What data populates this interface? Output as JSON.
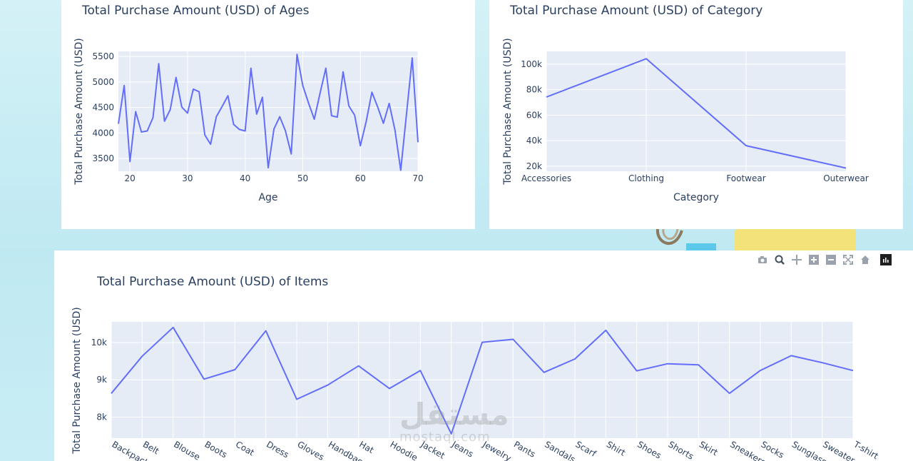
{
  "watermark": {
    "arabic": "مستقل",
    "latin": "mostaql.com"
  },
  "modebar": {
    "icons": [
      "camera-icon",
      "zoom-icon",
      "pan-icon",
      "zoom-in-icon",
      "zoom-out-icon",
      "autoscale-icon",
      "reset-axes-icon",
      "plotly-logo-icon"
    ]
  },
  "chart_data": [
    {
      "type": "line",
      "title": "Total Purchase Amount (USD) of Ages",
      "xlabel": "Age",
      "ylabel": "Total Purchase Amount (USD)",
      "x": [
        18,
        19,
        20,
        21,
        22,
        23,
        24,
        25,
        26,
        27,
        28,
        29,
        30,
        31,
        32,
        33,
        34,
        35,
        36,
        37,
        38,
        39,
        40,
        41,
        42,
        43,
        44,
        45,
        46,
        47,
        48,
        49,
        50,
        51,
        52,
        53,
        54,
        55,
        56,
        57,
        58,
        59,
        60,
        61,
        62,
        63,
        64,
        65,
        66,
        67,
        68,
        69,
        70
      ],
      "values": [
        4180,
        4930,
        3440,
        4420,
        4020,
        4040,
        4300,
        5360,
        4230,
        4460,
        5090,
        4510,
        4390,
        4860,
        4810,
        3960,
        3780,
        4320,
        4520,
        4730,
        4170,
        4070,
        4040,
        5270,
        4370,
        4700,
        3320,
        4080,
        4320,
        4040,
        3590,
        5540,
        4930,
        4590,
        4270,
        4780,
        5270,
        4340,
        4310,
        5200,
        4530,
        4350,
        3750,
        4220,
        4800,
        4510,
        4190,
        4580,
        4060,
        3270,
        4360,
        5470,
        3820
      ],
      "xlim": [
        18,
        70
      ],
      "ylim": [
        3250,
        5600
      ],
      "xticks": [
        20,
        30,
        40,
        50,
        60,
        70
      ],
      "yticks": [
        3500,
        4000,
        4500,
        5000,
        5500
      ],
      "ytick_labels": [
        "3500",
        "4000",
        "4500",
        "5000",
        "5500"
      ],
      "grid": true,
      "color": "#636efa",
      "plot_bg": "#e5ecf6"
    },
    {
      "type": "line",
      "title": "Total Purchase Amount (USD) of Category",
      "xlabel": "Category",
      "ylabel": "Total Purchase Amount (USD)",
      "categories": [
        "Accessories",
        "Clothing",
        "Footwear",
        "Outerwear"
      ],
      "values": [
        74200,
        104264,
        36093,
        18524
      ],
      "ylim": [
        16000,
        110000
      ],
      "yticks": [
        20000,
        40000,
        60000,
        80000,
        100000
      ],
      "ytick_labels": [
        "20k",
        "40k",
        "60k",
        "80k",
        "100k"
      ],
      "grid": true,
      "color": "#636efa",
      "plot_bg": "#e5ecf6"
    },
    {
      "type": "line",
      "title": "Total Purchase Amount (USD) of Items",
      "xlabel": "",
      "ylabel": "Total Purchase Amount (USD)",
      "categories": [
        "Backpack",
        "Belt",
        "Blouse",
        "Boots",
        "Coat",
        "Dress",
        "Gloves",
        "Handbag",
        "Hat",
        "Hoodie",
        "Jacket",
        "Jeans",
        "Jewelry",
        "Pants",
        "Sandals",
        "Scarf",
        "Shirt",
        "Shoes",
        "Shorts",
        "Skirt",
        "Sneakers",
        "Socks",
        "Sunglasses",
        "Sweater",
        "T-shirt"
      ],
      "values": [
        8634,
        9635,
        10410,
        9018,
        9274,
        10320,
        8477,
        8857,
        9375,
        8767,
        9249,
        7548,
        10010,
        10090,
        9200,
        9561,
        10332,
        9240,
        9433,
        9402,
        8635,
        9252,
        9649,
        9462,
        9248
      ],
      "ylim": [
        7430,
        10560
      ],
      "yticks": [
        8000,
        9000,
        10000
      ],
      "ytick_labels": [
        "8k",
        "9k",
        "10k"
      ],
      "grid": true,
      "color": "#636efa",
      "plot_bg": "#e5ecf6"
    }
  ]
}
